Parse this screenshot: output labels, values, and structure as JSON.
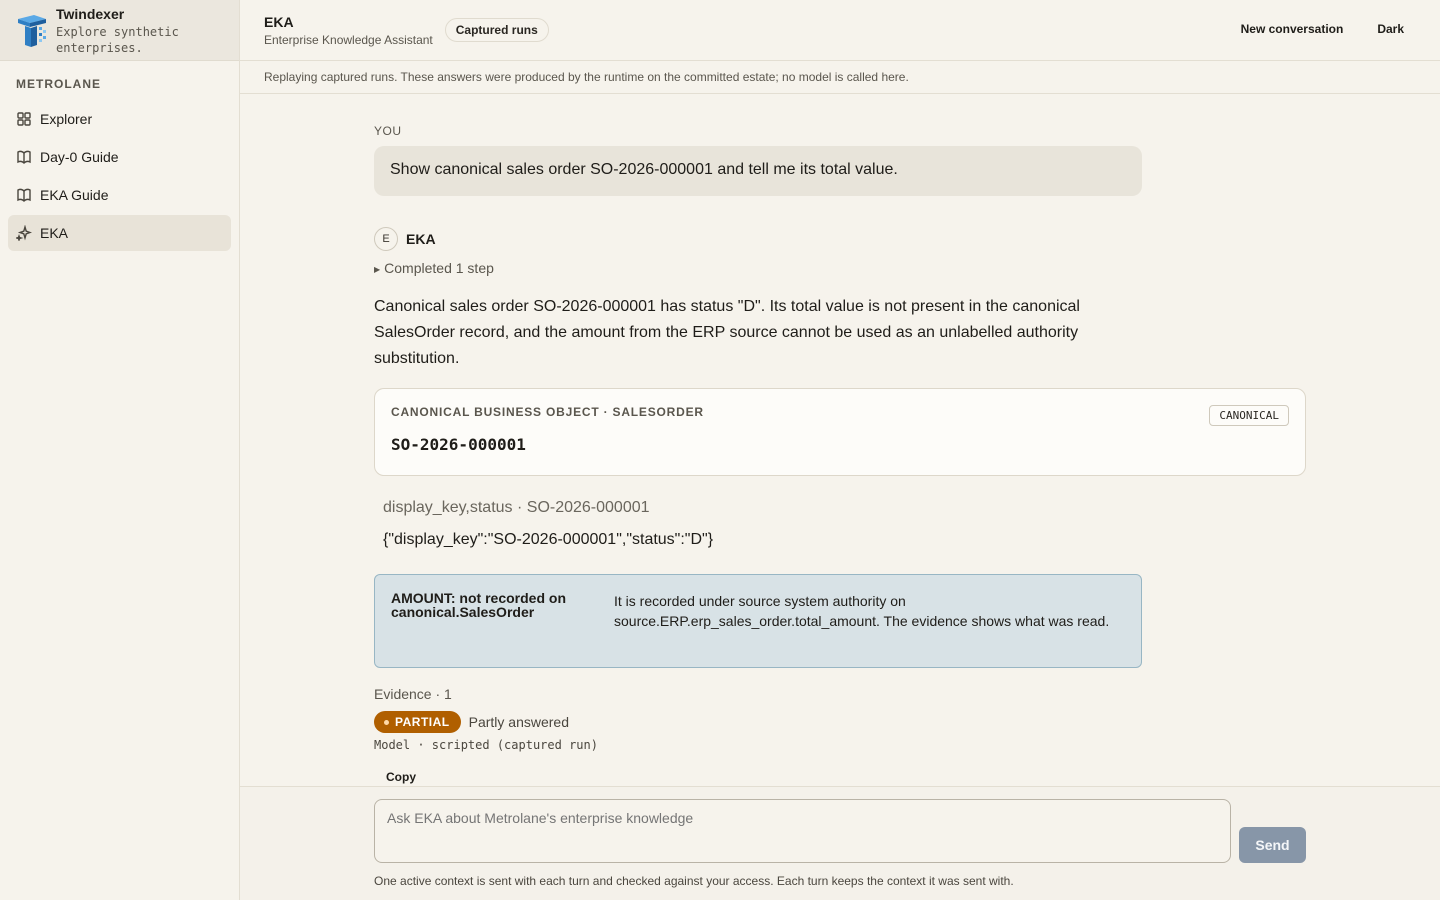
{
  "brand": {
    "title": "Twindexer",
    "subtitle": "Explore synthetic enterprises."
  },
  "sidebar": {
    "section": "METROLANE",
    "items": [
      {
        "label": "Explorer",
        "icon": "grid-icon"
      },
      {
        "label": "Day-0 Guide",
        "icon": "book-icon"
      },
      {
        "label": "EKA Guide",
        "icon": "book-icon"
      },
      {
        "label": "EKA",
        "icon": "sparkle-icon",
        "active": true
      }
    ]
  },
  "header": {
    "title": "EKA",
    "subtitle": "Enterprise Knowledge Assistant",
    "pill": "Captured runs",
    "new_conversation": "New conversation",
    "theme": "Dark"
  },
  "banner": "Replaying captured runs. These answers were produced by the runtime on the committed estate; no model is called here.",
  "conversation": {
    "you_label": "YOU",
    "user_message": "Show canonical sales order SO-2026-000001 and tell me its total value.",
    "assistant_avatar": "E",
    "assistant_name": "EKA",
    "steps": "Completed 1 step",
    "answer": "Canonical sales order SO-2026-000001 has status \"D\". Its total value is not present in the canonical SalesOrder record, and the amount from the ERP source cannot be used as an unlabelled authority substitution.",
    "card": {
      "eyebrow": "CANONICAL BUSINESS OBJECT · SALESORDER",
      "title": "SO-2026-000001",
      "badge": "CANONICAL"
    },
    "fields_label": "display_key,status · SO-2026-000001",
    "fields_value": "{\"display_key\":\"SO-2026-000001\",\"status\":\"D\"}",
    "notice": {
      "label": "AMOUNT: not recorded on canonical.SalesOrder",
      "text": "It is recorded under source system authority on source.ERP.erp_sales_order.total_amount. The evidence shows what was read."
    },
    "evidence": "Evidence · 1",
    "status_badge": "PARTIAL",
    "status_text": "Partly answered",
    "model_line": "Model · scripted (captured run)",
    "copy": "Copy"
  },
  "composer": {
    "placeholder": "Ask EKA about Metrolane's enterprise knowledge",
    "send": "Send",
    "note": "One active context is sent with each turn and checked against your access. Each turn keeps the context it was sent with."
  },
  "colors": {
    "accent_partial": "#b05f00",
    "notice_bg": "#d8e2e6",
    "send_bg": "#8796a8"
  }
}
